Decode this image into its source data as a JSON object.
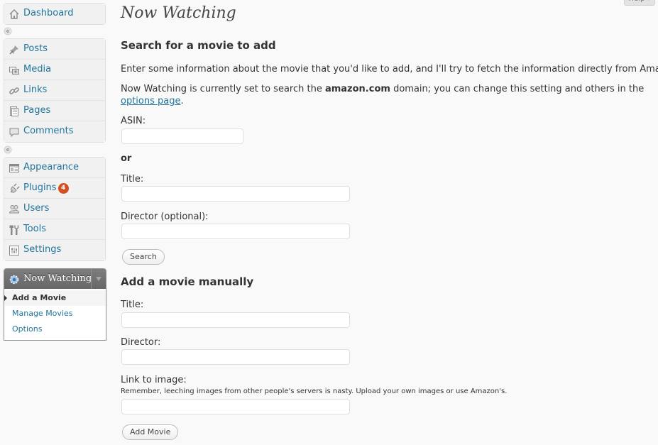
{
  "help": {
    "label": "Help ▾"
  },
  "sidebar": {
    "dashboard": {
      "label": "Dashboard",
      "icon": "dashboard-icon"
    },
    "group1": [
      {
        "label": "Posts",
        "icon": "pin-icon"
      },
      {
        "label": "Media",
        "icon": "media-icon"
      },
      {
        "label": "Links",
        "icon": "link-icon"
      },
      {
        "label": "Pages",
        "icon": "pages-icon"
      },
      {
        "label": "Comments",
        "icon": "comment-icon"
      }
    ],
    "group2": [
      {
        "label": "Appearance",
        "icon": "appearance-icon"
      },
      {
        "label": "Plugins",
        "icon": "plugin-icon",
        "badge": "4"
      },
      {
        "label": "Users",
        "icon": "users-icon"
      },
      {
        "label": "Tools",
        "icon": "tools-icon"
      },
      {
        "label": "Settings",
        "icon": "settings-icon"
      }
    ],
    "now_watching": {
      "label": "Now Watching",
      "icon": "gear-icon",
      "items": [
        "Add a Movie",
        "Manage Movies",
        "Options"
      ],
      "current": "Add a Movie"
    }
  },
  "main": {
    "title": "Now Watching",
    "search": {
      "heading": "Search for a movie to add",
      "intro": "Enter some information about the movie that you'd like to add, and I'll try to fetch the information directly from Amazon.",
      "domain_pre": "Now Watching is currently set to search the ",
      "domain": "amazon.com",
      "domain_post": " domain; you can change this setting and others in the",
      "options_link": "options page",
      "period": ".",
      "asin_label": "ASIN:",
      "or_label": "or",
      "title_label": "Title:",
      "director_label": "Director (optional):",
      "search_button": "Search"
    },
    "manual": {
      "heading": "Add a movie manually",
      "title_label": "Title:",
      "director_label": "Director:",
      "image_label": "Link to image:",
      "image_note": "Remember, leeching images from other people's servers is nasty. Upload your own images or use Amazon's.",
      "add_button": "Add Movie"
    }
  },
  "colors": {
    "link": "#21759b",
    "badge": "#d54e21",
    "active_menu": "#6d6d6d"
  }
}
